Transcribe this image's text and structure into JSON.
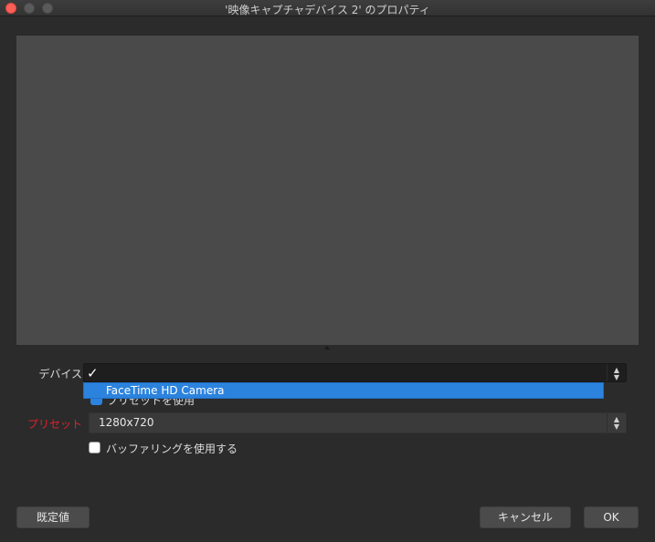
{
  "window": {
    "title": "'映像キャプチャデバイス 2' のプロパティ"
  },
  "form": {
    "device_label": "デバイス",
    "device_selected_mark": "✓",
    "device_dropdown_item": "FaceTime HD Camera",
    "hidden_checkbox_label": "プリセットを使用",
    "preset_label": "プリセット",
    "preset_value": "1280x720",
    "buffering_label": "バッファリングを使用する",
    "buffering_checked": false
  },
  "buttons": {
    "defaults": "既定値",
    "cancel": "キャンセル",
    "ok": "OK"
  },
  "icons": {
    "combo_arrows": "up-down-chevron-icon"
  },
  "colors": {
    "accent": "#2c83de",
    "preset_label": "#e0202a"
  }
}
